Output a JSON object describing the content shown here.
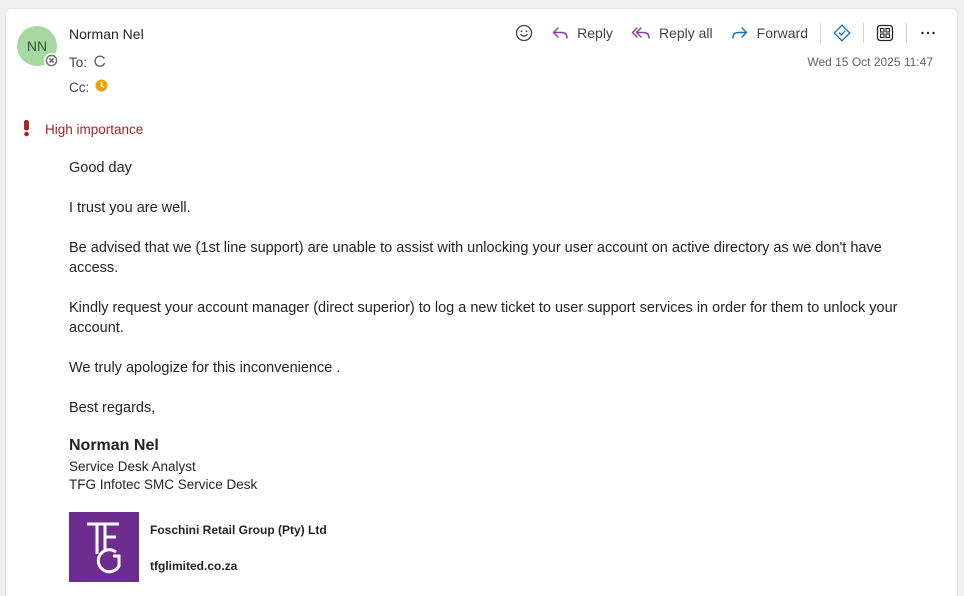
{
  "sender": {
    "initials": "NN",
    "name": "Norman Nel",
    "avatar_bg": "#a8d8a2"
  },
  "recipients": {
    "to_label": "To:",
    "cc_label": "Cc:"
  },
  "toolbar": {
    "reply_label": "Reply",
    "reply_all_label": "Reply all",
    "forward_label": "Forward"
  },
  "date": "Wed 15 Oct 2025 11:47",
  "importance": {
    "label": "High importance",
    "color": "#a4262c"
  },
  "body": {
    "greeting": "Good day",
    "line1": "I trust you are well.",
    "line2": "Be advised that we (1st line support) are unable to assist with unlocking your user account on active directory as we don't have access.",
    "line3": "Kindly request your account manager (direct superior) to log a new ticket to user support services in order for them to unlock your account.",
    "line4": "We truly apologize for this inconvenience .",
    "closing": "Best regards,"
  },
  "signature": {
    "name": "Norman Nel",
    "title": "Service Desk Analyst",
    "department": "TFG Infotec SMC Service Desk",
    "company": "Foschini Retail Group (Pty) Ltd",
    "website": "tfglimited.co.za",
    "logo_text": "TFG",
    "logo_color": "#6d2d8e"
  }
}
